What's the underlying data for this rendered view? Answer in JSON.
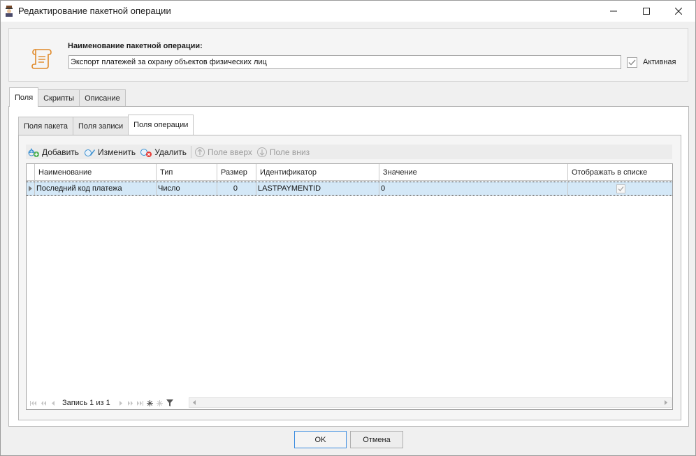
{
  "window": {
    "title": "Редактирование пакетной операции",
    "icon": "app-icon",
    "controls": [
      "minimize-icon",
      "maximize-icon",
      "close-icon"
    ]
  },
  "header": {
    "name_label": "Наименование пакетной операции:",
    "name_value": "Экспорт платежей за охрану объектов физических лиц",
    "active_label": "Активная",
    "active_checked": true,
    "icon": "scroll-icon",
    "accent_color": "#e08a2a"
  },
  "outer_tabs": [
    {
      "label": "Поля",
      "active": true
    },
    {
      "label": "Скрипты",
      "active": false
    },
    {
      "label": "Описание",
      "active": false
    }
  ],
  "inner_tabs": [
    {
      "label": "Поля пакета",
      "active": false
    },
    {
      "label": "Поля записи",
      "active": false
    },
    {
      "label": "Поля операции",
      "active": true
    }
  ],
  "toolbar": {
    "add": "Добавить",
    "edit": "Изменить",
    "delete": "Удалить",
    "move_up": "Поле вверх",
    "move_down": "Поле вниз"
  },
  "grid": {
    "columns": [
      "Наименование",
      "Тип",
      "Размер",
      "Идентификатор",
      "Значение",
      "Отображать в списке"
    ],
    "rows": [
      {
        "name": "Последний код платежа",
        "type": "Число",
        "size": "0",
        "identifier": "LASTPAYMENTID",
        "value": "0",
        "show_in_list": true
      }
    ],
    "selected_row_color": "#d4e8f7"
  },
  "navigator": {
    "record_text": "Запись 1 из 1"
  },
  "buttons": {
    "ok": "OK",
    "cancel": "Отмена"
  }
}
